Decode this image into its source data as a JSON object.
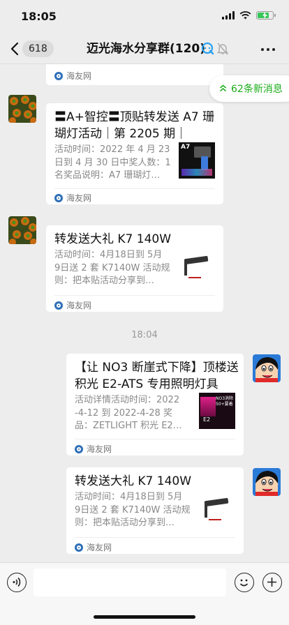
{
  "status": {
    "time": "18:05"
  },
  "nav": {
    "badge": "618",
    "title": "迈光海水分享群(120)"
  },
  "new_messages": {
    "label": "62条新消息",
    "color": "#1aad19"
  },
  "messages": [
    {
      "source": "海友网"
    },
    {
      "title_line1": "〓A+智控〓顶贴转发送 A7 珊",
      "title_line2": "瑚灯活动｜第 2205 期｜",
      "desc_line1": "活动时间：2022 年 4 月 23",
      "desc_line2": "日到 4 月 30 日中奖人数：1",
      "desc_line3": "名奖品说明：A7 珊瑚灯…",
      "thumb_label": "A7",
      "source": "海友网"
    },
    {
      "title_line1": "转发送大礼 K7 140W",
      "desc_line1": "活动时间：4月18日到 5月",
      "desc_line2": "9日送 2 套 K7140W 活动规",
      "desc_line3": "则：把本贴活动分享到…",
      "source": "海友网"
    },
    {
      "title_line1": "【让 NO3 断崖式下降】顶楼送",
      "title_line2": "积光 E2-ATS 专用照明灯具",
      "desc_line1": "活动详情活动时间：2022",
      "desc_line2": "-4-12 到 2022-4-28 奖",
      "desc_line3": "品：ZETLIGHT 积光 E2…",
      "thumb_text1": "NO3消除",
      "thumb_text2": "50+要着",
      "thumb_label": "E2",
      "source": "海友网"
    },
    {
      "title_line1": "转发送大礼 K7 140W",
      "desc_line1": "活动时间：4月18日到 5月",
      "desc_line2": "9日送 2 套 K7140W 活动规",
      "desc_line3": "则：把本贴活动分享到…",
      "source": "海友网"
    }
  ],
  "timestamp": "18:04",
  "icons": [
    "back-icon",
    "quan-icon",
    "mute-icon",
    "more-icon",
    "voice-icon",
    "emoji-icon",
    "plus-icon",
    "wifi-icon",
    "battery-icon"
  ]
}
